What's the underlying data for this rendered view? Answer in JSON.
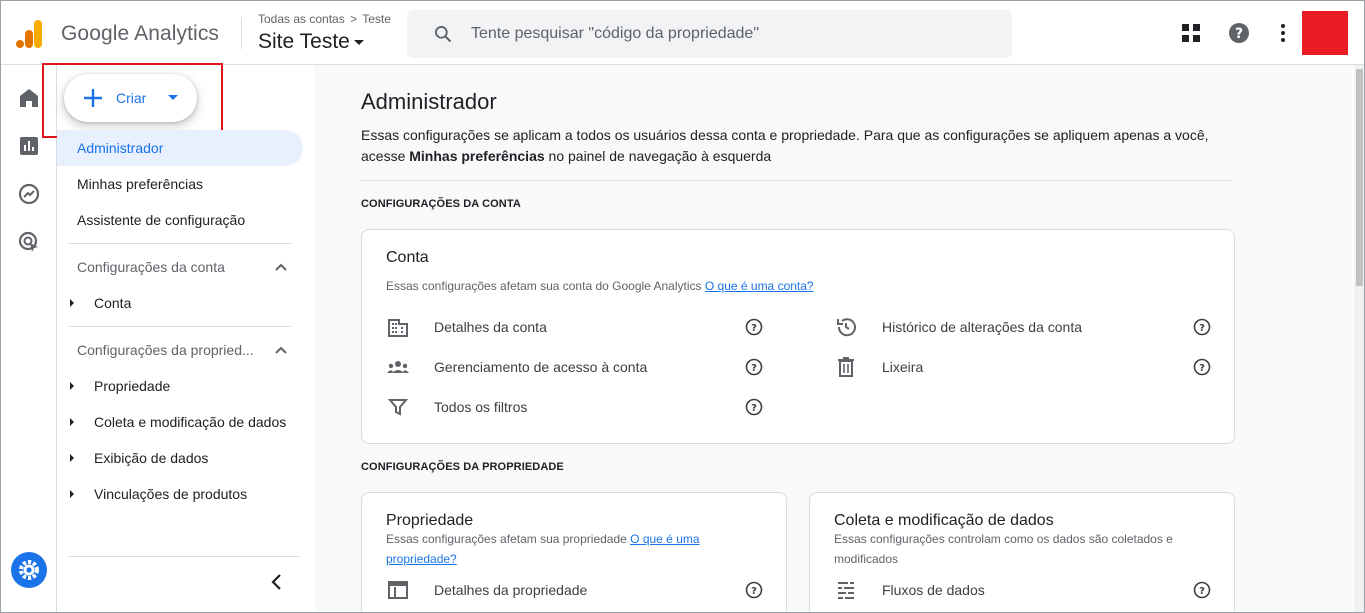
{
  "header": {
    "brand": "Google Analytics",
    "breadcrumb_account": "Todas as contas",
    "breadcrumb_property": "Teste",
    "site_name": "Site Teste",
    "search_placeholder": "Tente pesquisar \"código da propriedade\"",
    "icons": [
      "apps-grid-icon",
      "help-icon",
      "more-vert-icon"
    ],
    "avatar_color": "#ea1c24"
  },
  "rail": {
    "icons": [
      "home-icon",
      "reports-icon",
      "explore-icon",
      "advertising-icon",
      "admin-gear-icon"
    ]
  },
  "nav": {
    "create_label": "Criar",
    "items": [
      {
        "label": "Administrador",
        "active": true
      },
      {
        "label": "Minhas preferências"
      },
      {
        "label": "Assistente de configuração"
      }
    ],
    "account_group": {
      "label": "Configurações da conta",
      "items": [
        "Conta"
      ]
    },
    "property_group": {
      "label": "Configurações da propried...",
      "items": [
        "Propriedade",
        "Coleta e modificação de dados",
        "Exibição de dados",
        "Vinculações de produtos"
      ]
    }
  },
  "main": {
    "title": "Administrador",
    "intro_part1": "Essas configurações se aplicam a todos os usuários dessa conta e propriedade. Para que as configurações se apliquem apenas a você,",
    "intro_part2": "acesse ",
    "intro_bold": "Minhas preferências",
    "intro_part3": " no painel de navegação à esquerda",
    "account_section_label": "CONFIGURAÇÕES DA CONTA",
    "account_card": {
      "title": "Conta",
      "subtitle": "Essas configurações afetam sua conta do Google Analytics ",
      "subtitle_link": "O que é uma conta?",
      "rows_left": [
        "Detalhes da conta",
        "Gerenciamento de acesso à conta",
        "Todos os filtros"
      ],
      "rows_right": [
        "Histórico de alterações da conta",
        "Lixeira"
      ]
    },
    "property_section_label": "CONFIGURAÇÕES DA PROPRIEDADE",
    "property_card": {
      "title": "Propriedade",
      "subtitle": "Essas configurações afetam sua propriedade ",
      "subtitle_link": "O que é uma propriedade?",
      "rows": [
        "Detalhes da propriedade"
      ]
    },
    "data_card": {
      "title": "Coleta e modificação de dados",
      "subtitle": "Essas configurações controlam como os dados são coletados e modificados",
      "rows": [
        "Fluxos de dados"
      ]
    }
  },
  "colors": {
    "accent": "#1a73e8",
    "highlight_box": "#e0151d",
    "active_bg": "#e8f0fe"
  }
}
